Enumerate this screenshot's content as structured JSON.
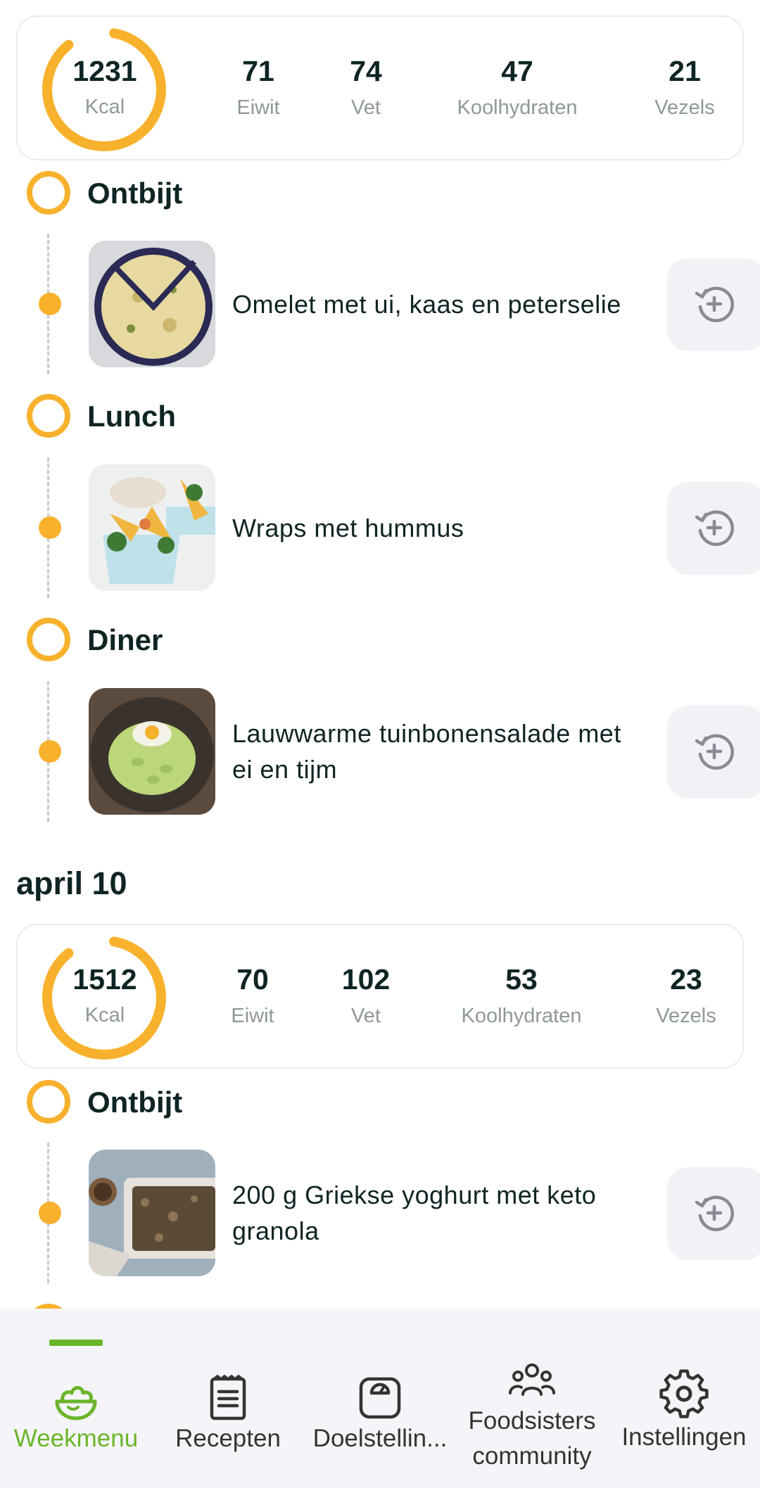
{
  "days": [
    {
      "summary": {
        "kcal": "1231",
        "kcal_label": "Kcal",
        "eiwit": "71",
        "eiwit_label": "Eiwit",
        "vet": "74",
        "vet_label": "Vet",
        "koolhydraten": "47",
        "koolhydraten_label": "Koolhydraten",
        "vezels": "21",
        "vezels_label": "Vezels"
      },
      "meals": [
        {
          "title": "Ontbijt",
          "recipe": "Omelet met ui, kaas en peterselie"
        },
        {
          "title": "Lunch",
          "recipe": "Wraps met hummus"
        },
        {
          "title": "Diner",
          "recipe": "Lauwwarme tuinbonensalade met ei en tijm"
        }
      ]
    },
    {
      "date": "april 10",
      "summary": {
        "kcal": "1512",
        "kcal_label": "Kcal",
        "eiwit": "70",
        "eiwit_label": "Eiwit",
        "vet": "102",
        "vet_label": "Vet",
        "koolhydraten": "53",
        "koolhydraten_label": "Koolhydraten",
        "vezels": "23",
        "vezels_label": "Vezels"
      },
      "meals": [
        {
          "title": "Ontbijt",
          "recipe": "200 g Griekse yoghurt met keto granola"
        }
      ]
    }
  ],
  "nav": {
    "weekmenu": "Weekmenu",
    "recepten": "Recepten",
    "doelstellingen": "Doelstellin...",
    "foodsisters": "Foodsisters community",
    "instellingen": "Instellingen",
    "active": "weekmenu"
  },
  "colors": {
    "accent": "#f8b12c",
    "nav_active": "#6ab52a",
    "text": "#0f2424",
    "muted": "#8e9898"
  },
  "icons": {
    "swap": "swap-recipe-icon",
    "weekmenu": "salad-bowl-icon",
    "recepten": "recipe-list-icon",
    "doelstellingen": "scale-icon",
    "foodsisters": "community-icon",
    "instellingen": "gear-icon"
  }
}
